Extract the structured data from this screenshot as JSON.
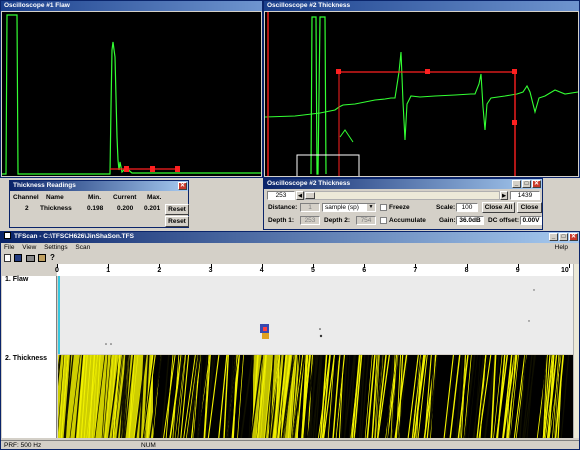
{
  "scope1": {
    "title": "Oscilloscope #1 Flaw"
  },
  "scope2": {
    "title": "Oscilloscope #2 Thickness"
  },
  "readings": {
    "title": "Thickness Readings",
    "headers": [
      "Channel",
      "Name",
      "Min.",
      "Current",
      "Max."
    ],
    "row": {
      "channel": "2",
      "name": "Thickness",
      "min": "0.198",
      "current": "0.200",
      "max": "0.201"
    },
    "reset_label": "Reset"
  },
  "scope2_ctrl": {
    "title": "Oscilloscope #2 Thickness",
    "pos_value": "253",
    "pos_end": "1439",
    "distance_label": "Distance:",
    "distance_value": "1",
    "unit_select": "sample (sp)",
    "freeze_label": "Freeze",
    "scale_label": "Scale:",
    "scale_value": "100",
    "close_all_label": "Close All",
    "close_label": "Close",
    "depth1_label": "Depth 1:",
    "depth1_value": "253",
    "depth2_label": "Depth 2:",
    "depth2_value": "754",
    "accumulate_label": "Accumulate",
    "gain_label": "Gain:",
    "gain_value": "36.0dB",
    "dc_label": "DC offset:",
    "dc_value": "0.00V"
  },
  "main": {
    "title": "TFScan - C:\\TFSCH626\\JinShaSon.TFS",
    "menu": [
      "File",
      "View",
      "Settings",
      "Scan"
    ],
    "help": "Help",
    "ruler": [
      "0",
      "1",
      "2",
      "3",
      "4",
      "5",
      "6",
      "7",
      "8",
      "9",
      "10"
    ],
    "track1": "1. Flaw",
    "track2": "2. Thickness",
    "status_prf": "PRF: 500 Hz",
    "status_num": "NUM"
  },
  "colors": {
    "trace": "#33ff33",
    "gate": "#ff2020",
    "cursor": "#ff2020",
    "scan_yellow": "#f2f200"
  }
}
